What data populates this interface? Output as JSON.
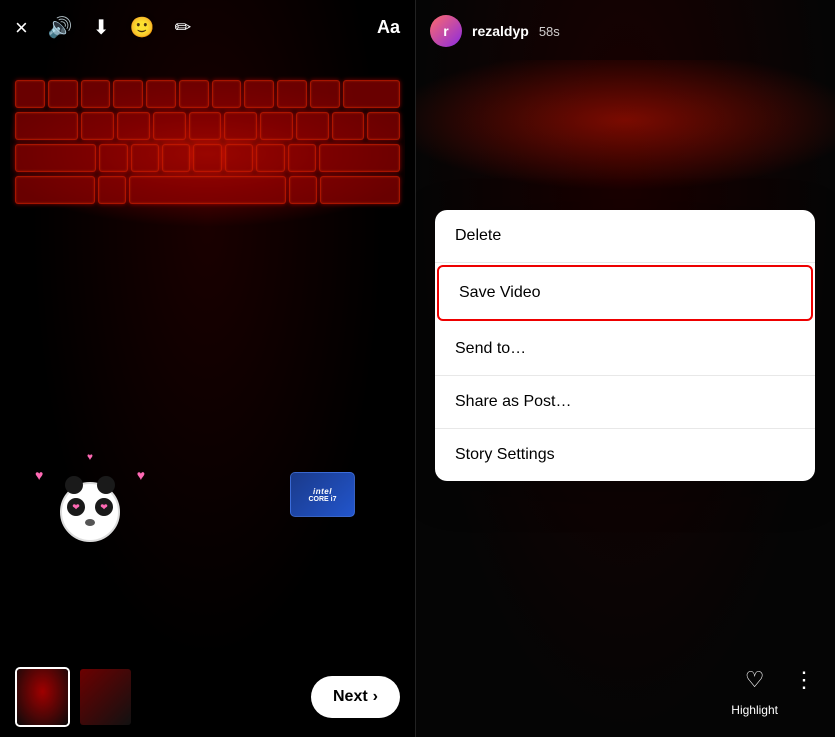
{
  "left": {
    "toolbar": {
      "close_icon": "×",
      "sound_icon": "🔊",
      "download_icon": "⬇",
      "sticker_icon": "🙂",
      "draw_icon": "✏",
      "text_label": "Aa"
    },
    "next_button": "Next",
    "next_arrow": "›"
  },
  "right": {
    "username": "rezaldyp",
    "timestamp": "58s",
    "menu": {
      "items": [
        {
          "id": "delete",
          "label": "Delete",
          "highlighted": false
        },
        {
          "id": "save-video",
          "label": "Save Video",
          "highlighted": true
        },
        {
          "id": "send-to",
          "label": "Send to…",
          "highlighted": false
        },
        {
          "id": "share-as-post",
          "label": "Share as Post…",
          "highlighted": false
        },
        {
          "id": "story-settings",
          "label": "Story Settings",
          "highlighted": false
        }
      ]
    },
    "actions": {
      "highlight_label": "Highlight",
      "more_label": "More"
    }
  },
  "colors": {
    "accent_red": "#e00000",
    "bg_dark": "#0a0a0a",
    "menu_bg": "#ffffff",
    "text_primary": "#000000",
    "text_white": "#ffffff"
  }
}
